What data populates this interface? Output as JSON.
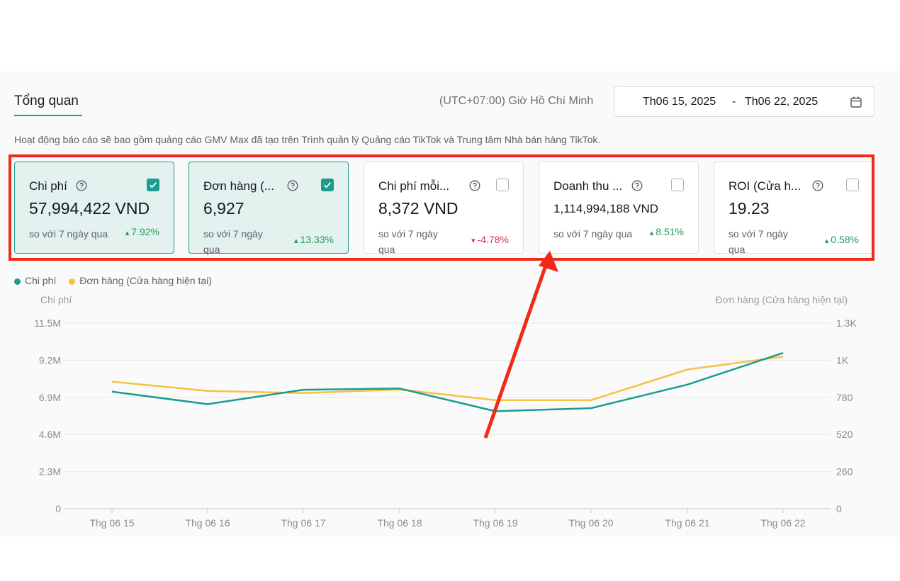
{
  "header": {
    "tab": "Tổng quan",
    "timezone": "(UTC+07:00) Giờ Hồ Chí Minh",
    "date_start": "Th06 15, 2025",
    "date_sep": "-",
    "date_end": "Th06 22, 2025",
    "calendar_icon": "calendar-icon"
  },
  "description": "Hoạt động báo cáo sẽ bao gồm quảng cáo GMV Max đã tạo trên Trình quản lý Quảng cáo TikTok và Trung tâm Nhà bán hàng TikTok.",
  "cards": [
    {
      "title": "Chi phí",
      "value": "57,994,422 VND",
      "compare": "so với 7 ngày qua",
      "change": "7.92%",
      "direction": "up",
      "checked": true
    },
    {
      "title": "Đơn hàng (...",
      "value": "6,927",
      "compare": "so với 7 ngày qua",
      "change": "13.33%",
      "direction": "up",
      "checked": true
    },
    {
      "title": "Chi phí mỗi...",
      "value": "8,372 VND",
      "compare": "so với 7 ngày qua",
      "change": "-4.78%",
      "direction": "down",
      "checked": false
    },
    {
      "title": "Doanh thu ...",
      "value": "1,114,994,188 VND",
      "compare": "so với 7 ngày qua",
      "change": "8.51%",
      "direction": "up",
      "checked": false
    },
    {
      "title": "ROI (Cửa h...",
      "value": "19.23",
      "compare": "so với 7 ngày qua",
      "change": "0.58%",
      "direction": "up",
      "checked": false
    }
  ],
  "colors": {
    "accent": "#1a9c8f",
    "series_cost": "#1a9c8f",
    "series_orders": "#f7c144",
    "highlight_red": "#f02a16",
    "up": "#1f9d55",
    "down": "#d8344b"
  },
  "chart_data": {
    "type": "line",
    "legend": [
      "Chi phí",
      "Đơn hàng (Cửa hàng hiện tại)"
    ],
    "ylabel_left": "Chi phí",
    "ylabel_right": "Đơn hàng (Cửa hàng hiện tại)",
    "categories": [
      "Thg 06 15",
      "Thg 06 16",
      "Thg 06 17",
      "Thg 06 18",
      "Thg 06 19",
      "Thg 06 20",
      "Thg 06 21",
      "Thg 06 22"
    ],
    "left_ticks": [
      "0",
      "2.3M",
      "4.6M",
      "6.9M",
      "9.2M",
      "11.5M"
    ],
    "right_ticks": [
      "0",
      "260",
      "520",
      "780",
      "1K",
      "1.3K"
    ],
    "ylim_left": [
      0,
      11500000
    ],
    "ylim_right": [
      0,
      1300
    ],
    "series": [
      {
        "name": "Chi phí",
        "axis": "left",
        "values": [
          7250000,
          6480000,
          7370000,
          7450000,
          6040000,
          6230000,
          7690000,
          9650000
        ]
      },
      {
        "name": "Đơn hàng (Cửa hàng hiện tại)",
        "axis": "right",
        "values": [
          890,
          825,
          810,
          835,
          760,
          760,
          975,
          1065
        ]
      }
    ],
    "grid": true,
    "legend_position": "top-left"
  }
}
